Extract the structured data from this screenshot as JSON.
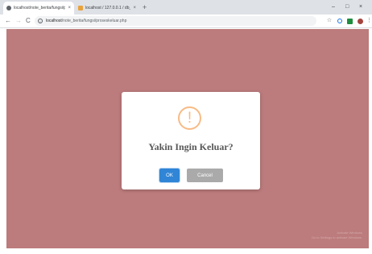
{
  "browser": {
    "tabs": [
      {
        "title": "localhost/note_berita/fungsi/p",
        "favicon_color": "#5f6368",
        "close": "×"
      },
      {
        "title": "localhost / 127.0.0.1 / db_berita",
        "favicon_color": "#e8a33d",
        "close": "×"
      }
    ],
    "new_tab": "+",
    "window_controls": {
      "minimize": "–",
      "maximize": "□",
      "close": "×"
    },
    "nav": {
      "back": "←",
      "forward": "→",
      "reload": "C"
    },
    "address": {
      "host": "localhost",
      "path": "/note_berita/fungsi/proseskeluar.php"
    }
  },
  "dialog": {
    "icon": "!",
    "title": "Yakin Ingin Keluar?",
    "confirm_label": "OK",
    "cancel_label": "Cancel"
  },
  "watermark": {
    "line1": "Activate Windows",
    "line2": "Go to Settings to activate Windows."
  },
  "colors": {
    "page_background": "#bc7b7c",
    "confirm": "#3085d6",
    "cancel": "#aaaaaa",
    "warning": "#f8bb86"
  }
}
